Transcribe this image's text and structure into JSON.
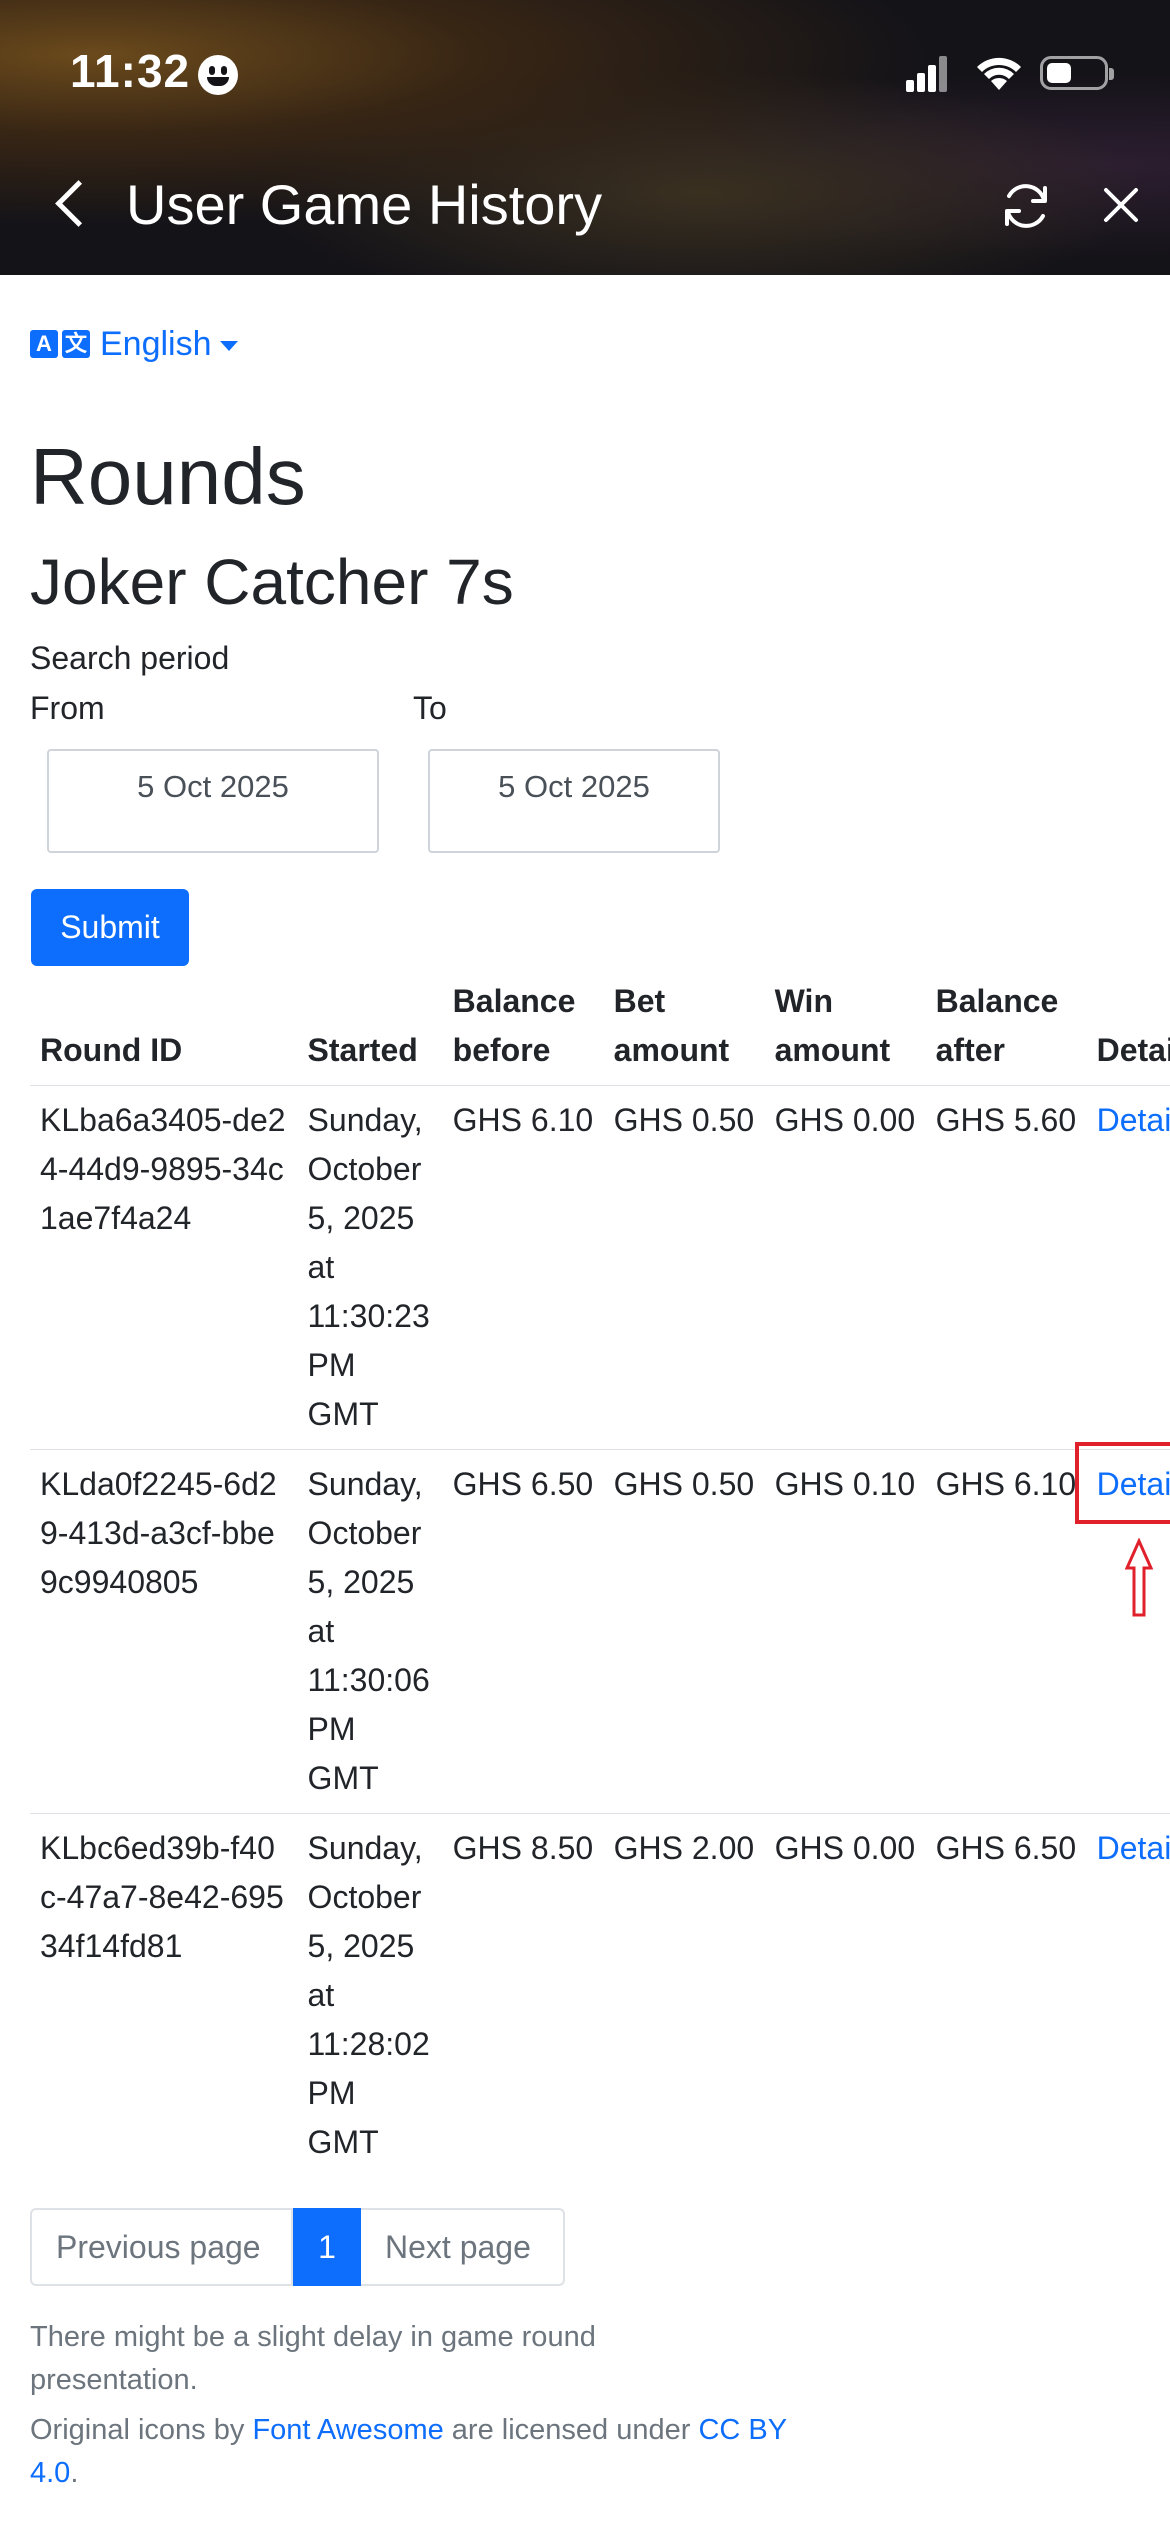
{
  "status_bar": {
    "time": "11:32"
  },
  "header": {
    "title": "User Game History"
  },
  "language": {
    "label": "English"
  },
  "page": {
    "title": "Rounds",
    "subtitle": "Joker Catcher 7s"
  },
  "search": {
    "period_label": "Search period",
    "from_label": "From",
    "to_label": "To",
    "from_value": "5 Oct 2025",
    "to_value": "5 Oct 2025",
    "submit_label": "Submit"
  },
  "table": {
    "headers": [
      "Round ID",
      "Started",
      "Balance before",
      "Bet amount",
      "Win amount",
      "Balance after",
      "Details"
    ],
    "rows": [
      {
        "round_id": "KLba6a3405-de24-44d9-9895-34c1ae7f4a24",
        "started": "Sunday, October 5, 2025 at 11:30:23 PM GMT",
        "balance_before": "GHS 6.10",
        "bet_amount": "GHS 0.50",
        "win_amount": "GHS 0.00",
        "balance_after": "GHS 5.60",
        "details": "Details"
      },
      {
        "round_id": "KLda0f2245-6d29-413d-a3cf-bbe9c9940805",
        "started": "Sunday, October 5, 2025 at 11:30:06 PM GMT",
        "balance_before": "GHS 6.50",
        "bet_amount": "GHS 0.50",
        "win_amount": "GHS 0.10",
        "balance_after": "GHS 6.10",
        "details": "Details"
      },
      {
        "round_id": "KLbc6ed39b-f40c-47a7-8e42-69534f14fd81",
        "started": "Sunday, October 5, 2025 at 11:28:02 PM GMT",
        "balance_before": "GHS 8.50",
        "bet_amount": "GHS 2.00",
        "win_amount": "GHS 0.00",
        "balance_after": "GHS 6.50",
        "details": "Details"
      }
    ]
  },
  "pagination": {
    "prev_label": "Previous page",
    "current_page": "1",
    "next_label": "Next page"
  },
  "footer": {
    "note": "There might be a slight delay in game round presentation.",
    "credits_prefix": "Original icons by ",
    "credits_link1": "Font Awesome",
    "credits_middle": " are licensed under ",
    "credits_link2": "CC BY 4.0",
    "credits_suffix": "."
  },
  "colors": {
    "accent": "#0d6efd",
    "annotation": "#e0202a",
    "muted": "#6c757d"
  },
  "icons": [
    "back-chevron-icon",
    "refresh-icon",
    "close-icon",
    "translate-icon",
    "caret-down-icon",
    "signal-icon",
    "wifi-icon",
    "battery-icon"
  ]
}
